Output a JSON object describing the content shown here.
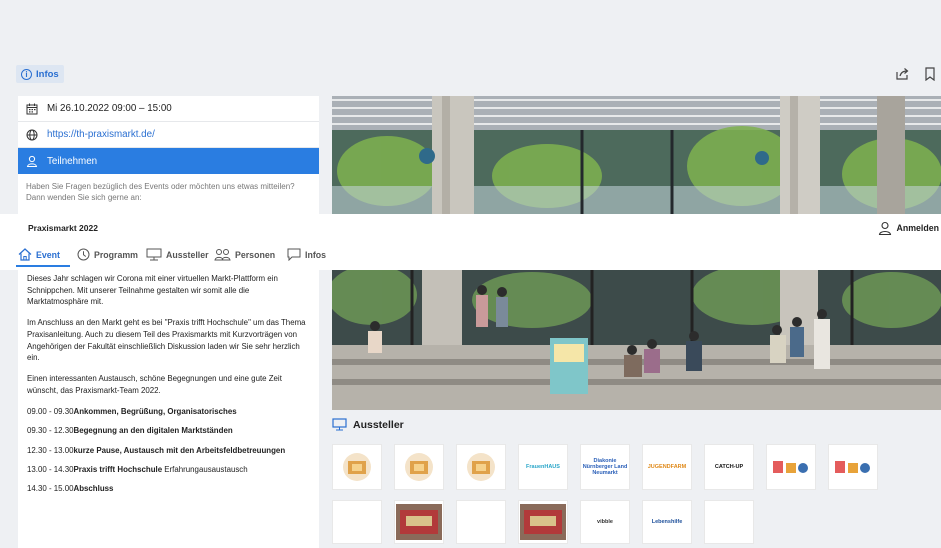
{
  "topbar": {
    "infos_label": "Infos"
  },
  "info_card": {
    "date": "Mi 26.10.2022 09:00 – 15:00",
    "website": "https://th-praxismarkt.de/",
    "join": "Teilnehmen",
    "question": "Haben Sie Fragen bezüglich des Events oder möchten uns etwas mitteilen? Dann wenden Sie sich gerne an:"
  },
  "event": {
    "title": "Praxismarkt 2022",
    "login": "Anmelden"
  },
  "tabs": [
    {
      "label": "Event"
    },
    {
      "label": "Programm"
    },
    {
      "label": "Aussteller"
    },
    {
      "label": "Personen"
    },
    {
      "label": "Infos"
    }
  ],
  "description": {
    "p1": "Dieses Jahr schlagen wir Corona mit einer virtuellen Markt-Plattform ein Schnippchen. Mit unserer Teilnahme gestalten wir somit alle die Marktatmosphäre mit.",
    "p2": "Im Anschluss an den Markt geht es bei \"Praxis trifft Hochschule\" um das Thema Praxisanleitung. Auch zu diesem Teil des Praxismarkts mit Kurzvorträgen von Angehörigen der Fakultät einschließlich Diskussion laden wir Sie sehr herzlich ein.",
    "p3": "Einen interessanten Austausch, schöne Begegnungen und eine gute Zeit wünscht, das Praxismarkt-Team 2022."
  },
  "schedule": [
    {
      "time": "09.00 - 09.30 ",
      "title": "Ankommen, Begrüßung, Organisatorisches",
      "extra": ""
    },
    {
      "time": "09.30 - 12.30 ",
      "title": "Begegnung an den digitalen Marktständen",
      "extra": ""
    },
    {
      "time": "12.30 - 13.00 ",
      "title": "kurze Pause, Austausch mit den Arbeitsfeldbetreuungen",
      "extra": ""
    },
    {
      "time": "13.00 - 14.30 ",
      "title": "Praxis trifft Hochschule",
      "extra": " Erfahrungausaustausch"
    },
    {
      "time": "14.30 - 15.00 ",
      "title": "Abschluss",
      "extra": ""
    }
  ],
  "exhibitors": {
    "heading": "Aussteller",
    "logos": [
      {
        "name": "",
        "kind": "folder"
      },
      {
        "name": "",
        "kind": "folder"
      },
      {
        "name": "",
        "kind": "folder"
      },
      {
        "name": "FrauenHAUS",
        "kind": "text"
      },
      {
        "name": "Diakonie Nürnberger Land Neumarkt",
        "kind": "text"
      },
      {
        "name": "JUGENDFARM",
        "kind": "text"
      },
      {
        "name": "CATCH-UP",
        "kind": "text"
      },
      {
        "name": "",
        "kind": "mixed"
      },
      {
        "name": "",
        "kind": "mixed"
      },
      {
        "name": "",
        "kind": "text"
      },
      {
        "name": "",
        "kind": "photo"
      },
      {
        "name": "",
        "kind": "text"
      },
      {
        "name": "",
        "kind": "photo"
      },
      {
        "name": "vibble",
        "kind": "text"
      },
      {
        "name": "Lebenshilfe",
        "kind": "text"
      },
      {
        "name": "",
        "kind": "text"
      }
    ]
  },
  "colors": {
    "accent": "#2a7de1",
    "link": "#2a6fd1",
    "background": "#eef0f3"
  }
}
